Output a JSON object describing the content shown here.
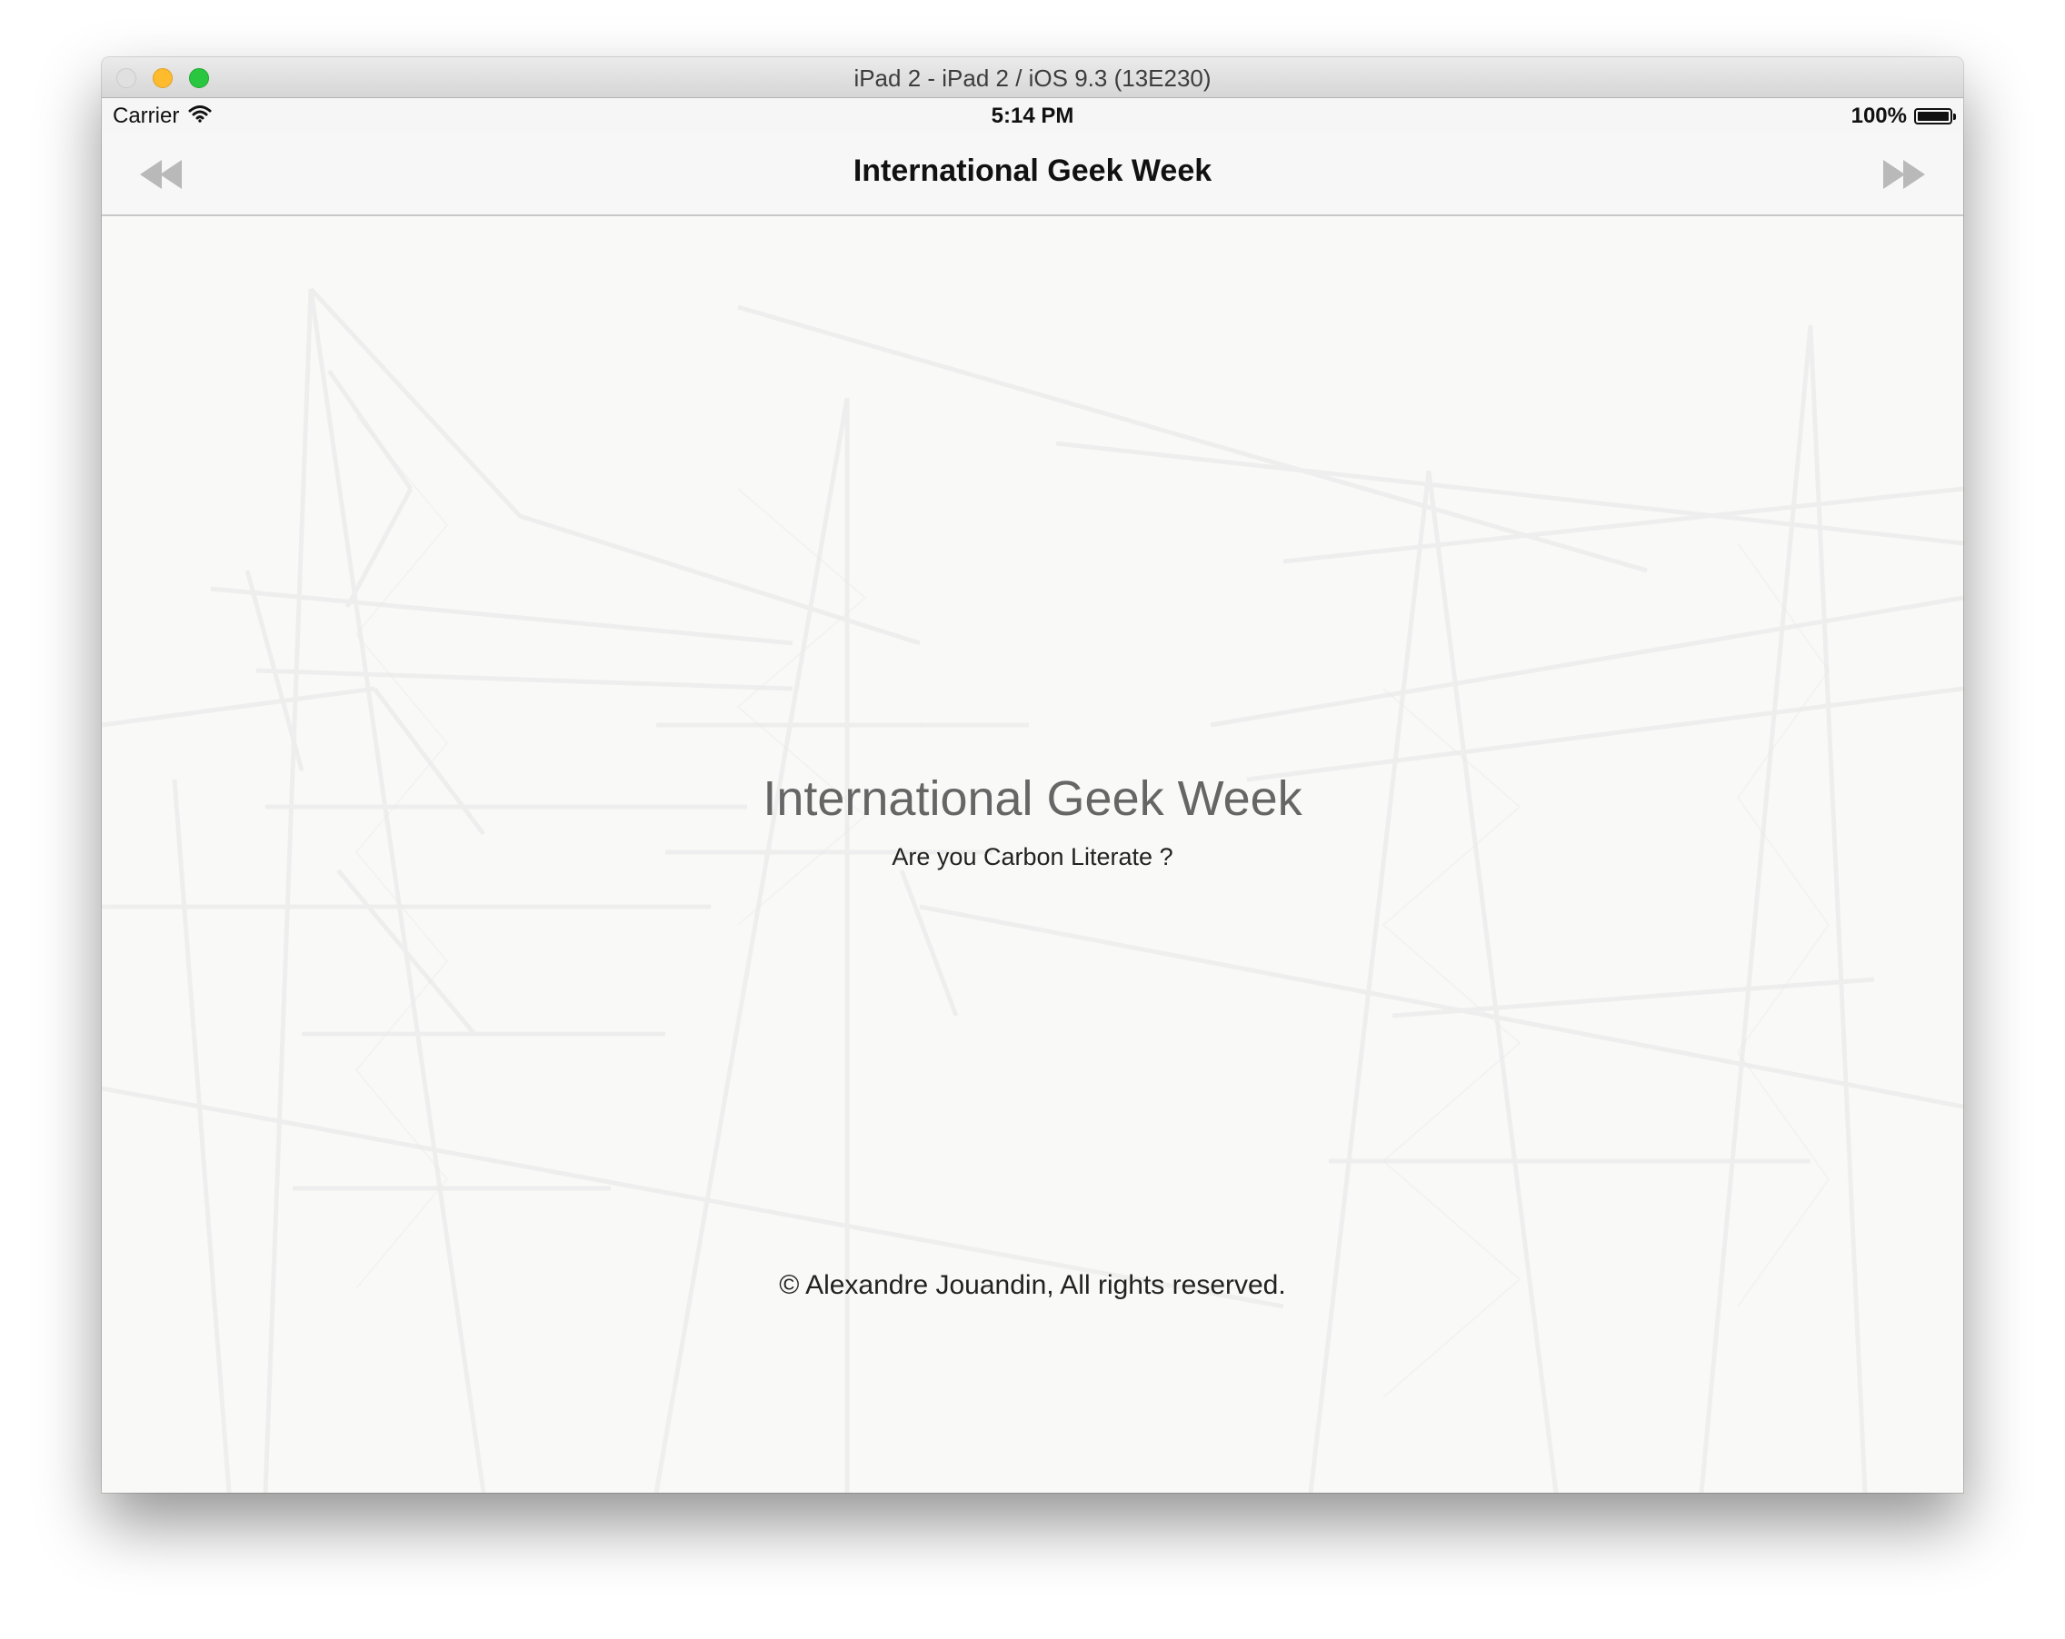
{
  "window": {
    "title": "iPad 2 - iPad 2 / iOS 9.3 (13E230)"
  },
  "status_bar": {
    "carrier": "Carrier",
    "time": "5:14 PM",
    "battery": "100%"
  },
  "nav": {
    "title": "International Geek Week",
    "back_icon": "rewind-icon",
    "forward_icon": "fast-forward-icon"
  },
  "main": {
    "title": "International Geek Week",
    "subtitle": "Are you Carbon Literate ?",
    "copyright": "© Alexandre Jouandin, All rights reserved."
  },
  "colors": {
    "nav_icon": "#b9b9b9",
    "title_text": "#666666",
    "background": "#f9f9f8"
  }
}
